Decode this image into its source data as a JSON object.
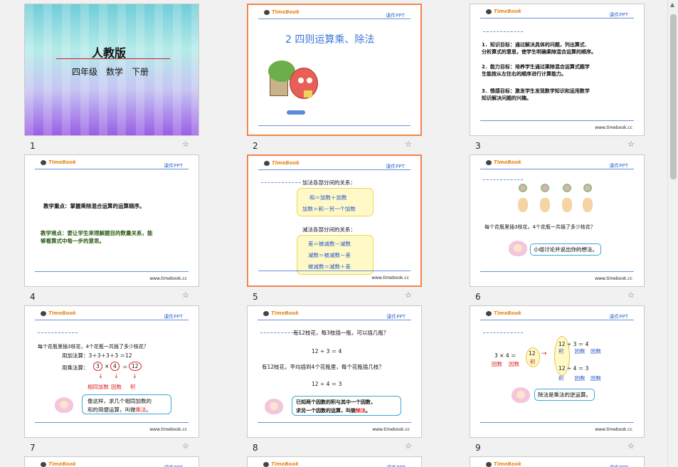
{
  "slides": [
    {
      "num": "1",
      "title": "人教版",
      "subtitle": "四年级　数学　下册"
    },
    {
      "num": "2",
      "title": "2 四则运算乘、除法"
    },
    {
      "num": "3",
      "l1": "1．知识目标：通过解决具体的问题，列出算式．",
      "l2": "分析算式的意思，使学生明确乘除混合运算的顺序。",
      "l3": "2．能力目标：培养学生通过乘除混合运算式题学",
      "l4": "生能按从左往右的顺序进行计算能力。",
      "l5": "3．情感目标：激发学生发现数学知识和运用数学",
      "l6": "知识解决问题的兴趣。"
    },
    {
      "num": "4",
      "l1": "教学重点：掌握乘除混合运算的运算顺序。",
      "l2": "教学难点：要让学生来理解题目的数量关系，能",
      "l3": "够看算式中每一步的意思。"
    },
    {
      "num": "5",
      "h1": "加法各部分间的关系：",
      "a1": "和＝加数＋加数",
      "a2": "加数＝和－另一个加数",
      "h2": "减法各部分间的关系：",
      "s1": "差＝被减数－减数",
      "s2": "减数＝被减数－差",
      "s3": "被减数＝减数＋差"
    },
    {
      "num": "6",
      "q": "每个花瓶里插3枝花，4个花瓶一共插了多少枝花？",
      "b": "小组讨论并说出你的想法。"
    },
    {
      "num": "7",
      "q": "每个花瓶里插3枝花，4个花瓶一共插了多少枝花？",
      "add": "用加法算：3＋3＋3＋3 ＝12",
      "mul": "用乘法算：",
      "n1": "3",
      "x": "×",
      "n2": "4",
      "eq": "＝",
      "n3": "12",
      "lb1": "相同加数",
      "lb2": "因数",
      "lb3": "积",
      "b1": "像这样，求几个相同加数的",
      "b2": "和的简便运算，叫做",
      "b3": "乘法",
      "b4": "。"
    },
    {
      "num": "8",
      "q1": "有12枝花，每3枝插一瓶，可以插几瓶？",
      "e1": "12 ÷ 3 ＝ 4",
      "q2": "有12枝花，平均插到4个花瓶里，每个花瓶插几枝？",
      "e2": "12 ÷ 4 ＝ 3",
      "b1": "已知两个因数的积与其中一个因数，",
      "b2": "求另一个因数的运算，叫做",
      "b3": "除法",
      "b4": "。"
    },
    {
      "num": "9",
      "e0": "3 × 4 ＝",
      "p12": "12",
      "plab": "积",
      "l1": "因数",
      "l2": "因数",
      "r1": "12 ÷ 3 ＝ 4",
      "r2": "12 ÷ 4 ＝ 3",
      "ra": "积",
      "rb": "因数",
      "rc": "因数",
      "b": "除法是乘法的逆运算。"
    }
  ],
  "brand": "TimeBook",
  "tag": "课件PPT",
  "site": "www.timebook.cc",
  "star": "☆"
}
